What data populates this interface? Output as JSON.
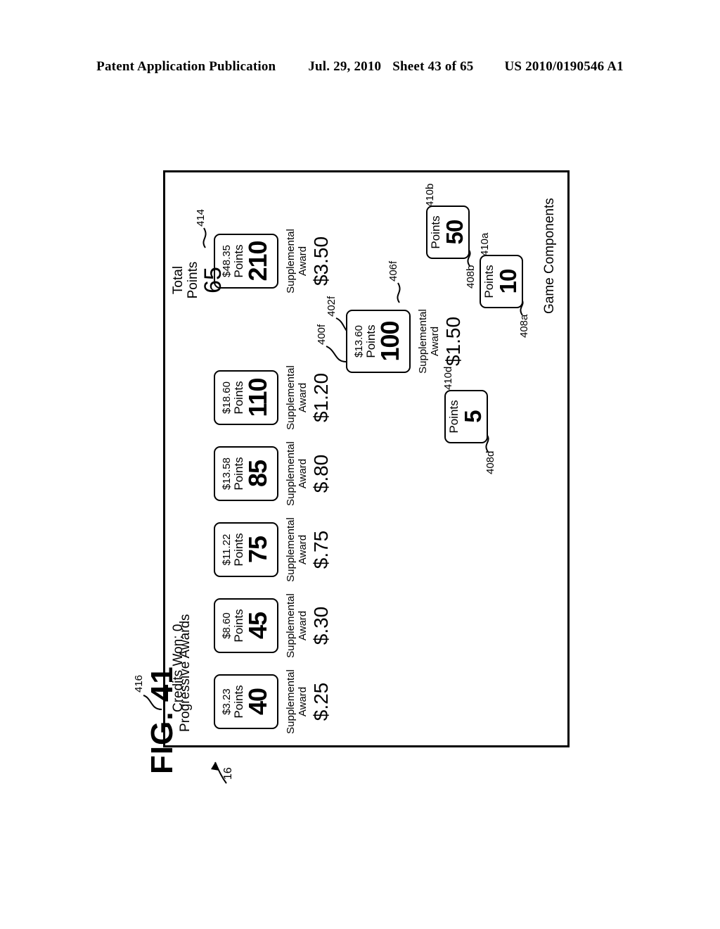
{
  "header": {
    "publication": "Patent Application Publication",
    "date": "Jul. 29, 2010",
    "sheet": "Sheet 43 of 65",
    "number": "US 2010/0190546 A1"
  },
  "figure": {
    "caption": "FIG. 41",
    "device_ref": "16"
  },
  "screen": {
    "credits_won": {
      "label": "Credits Won: 0",
      "ref": "416"
    },
    "progressive_section_title": "Progressive Awards",
    "game_components_title": "Game Components"
  },
  "progressive_awards": [
    {
      "amount": "$3.23",
      "points_label": "Points",
      "points": "40",
      "supp_label_1": "Supplemental",
      "supp_label_2": "Award",
      "supp_value": "$.25"
    },
    {
      "amount": "$8.60",
      "points_label": "Points",
      "points": "45",
      "supp_label_1": "Supplemental",
      "supp_label_2": "Award",
      "supp_value": "$.30"
    },
    {
      "amount": "$11.22",
      "points_label": "Points",
      "points": "75",
      "supp_label_1": "Supplemental",
      "supp_label_2": "Award",
      "supp_value": "$.75"
    },
    {
      "amount": "$13.58",
      "points_label": "Points",
      "points": "85",
      "supp_label_1": "Supplemental",
      "supp_label_2": "Award",
      "supp_value": "$.80"
    },
    {
      "amount": "$18.60",
      "points_label": "Points",
      "points": "110",
      "supp_label_1": "Supplemental",
      "supp_label_2": "Award",
      "supp_value": "$1.20"
    },
    {
      "amount": "$48.35",
      "points_label": "Points",
      "points": "210",
      "supp_label_1": "Supplemental",
      "supp_label_2": "Award",
      "supp_value": "$3.50"
    }
  ],
  "selected_award": {
    "amount": "$13.60",
    "points_label": "Points",
    "points": "100",
    "amount_ref": "400f",
    "points_ref": "402f",
    "supp_label_1": "Supplemental",
    "supp_label_2": "Award",
    "supp_value": "$1.50",
    "supp_ref": "406f"
  },
  "total_points": {
    "label_1": "Total",
    "label_2": "Points",
    "value": "65",
    "ref": "414"
  },
  "game_components": [
    {
      "points_label": "Points",
      "points": "10",
      "box_ref": "408a",
      "value_ref": "410a"
    },
    {
      "points_label": "Points",
      "points": "50",
      "box_ref": "408b",
      "value_ref": "410b"
    },
    {
      "points_label": "Points",
      "points": "5",
      "box_ref": "408d",
      "value_ref": "410d"
    }
  ]
}
